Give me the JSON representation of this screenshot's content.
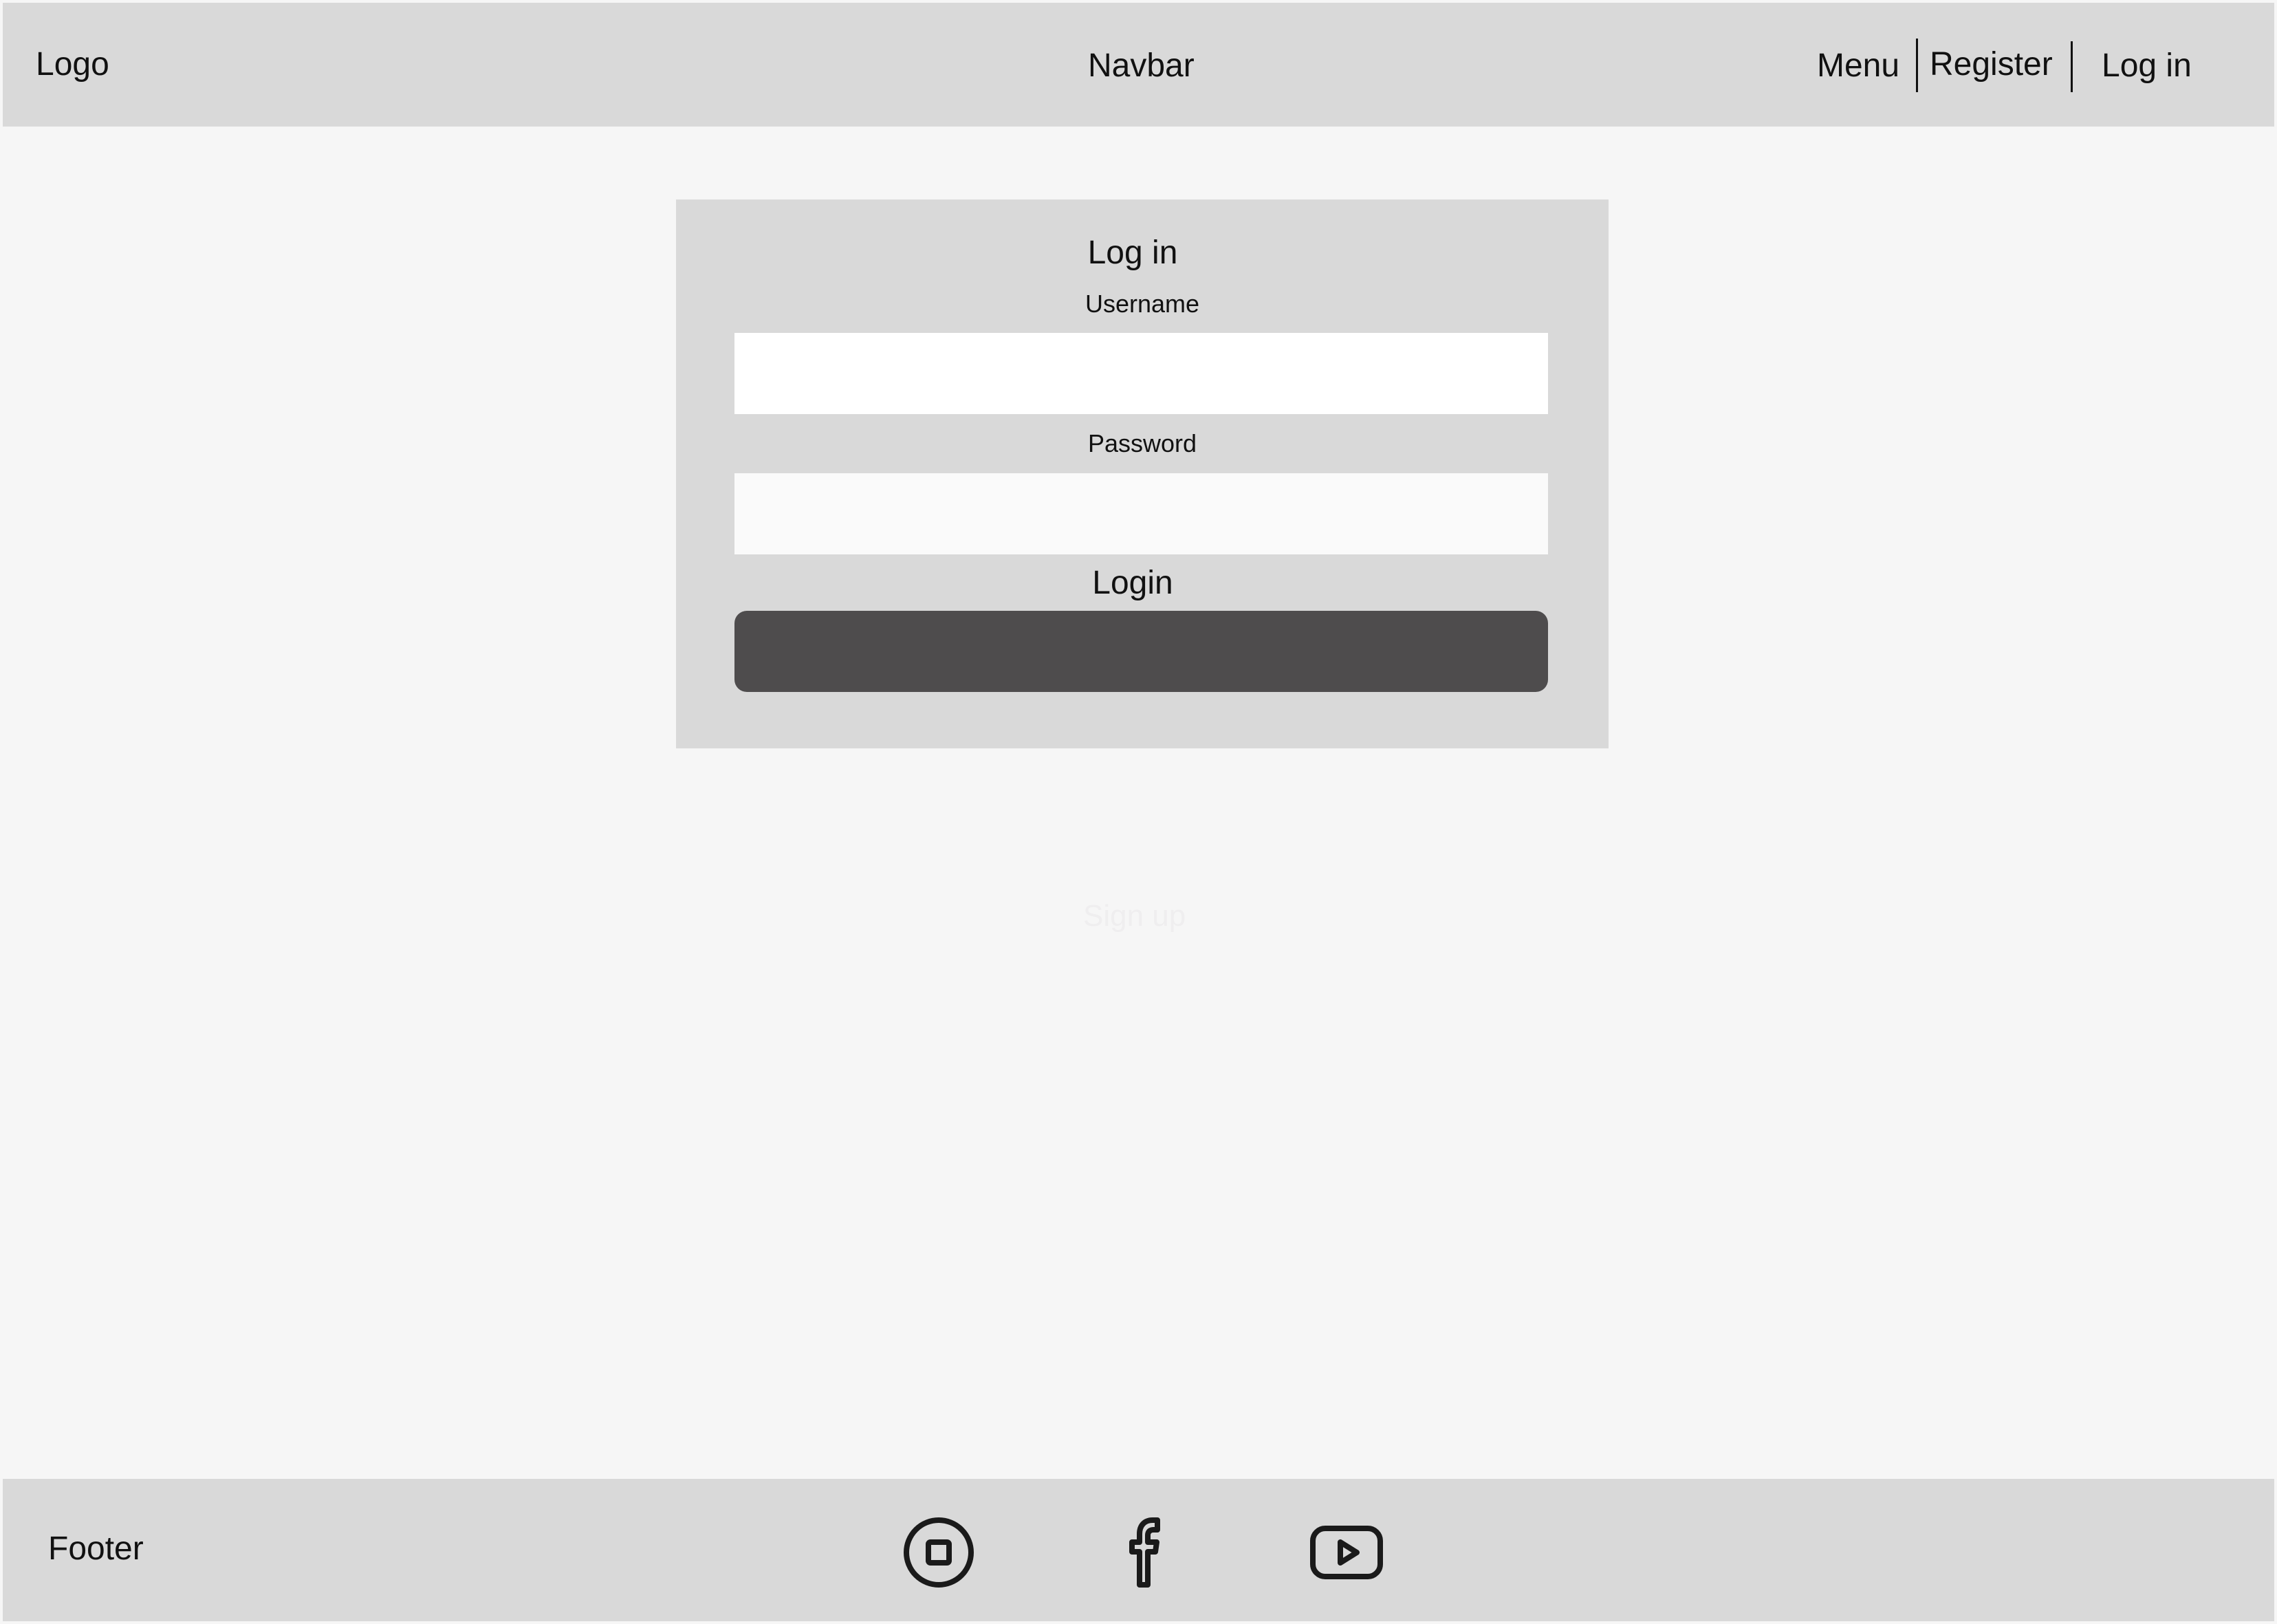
{
  "navbar": {
    "logo": "Logo",
    "title": "Navbar",
    "links": {
      "menu": "Menu",
      "register": "Register",
      "login": "Log in"
    }
  },
  "login_card": {
    "title": "Log in",
    "username_label": "Username",
    "username_value": "",
    "password_label": "Password",
    "password_value": "",
    "button_label": "Login"
  },
  "signup": {
    "label": "Sign up"
  },
  "footer": {
    "label": "Footer",
    "icons": [
      "instagram-icon",
      "facebook-icon",
      "youtube-icon"
    ]
  },
  "colors": {
    "page_background": "#f6f6f6",
    "panel_background": "#d9d9d9",
    "button": "#4e4c4d",
    "text": "#111111"
  }
}
